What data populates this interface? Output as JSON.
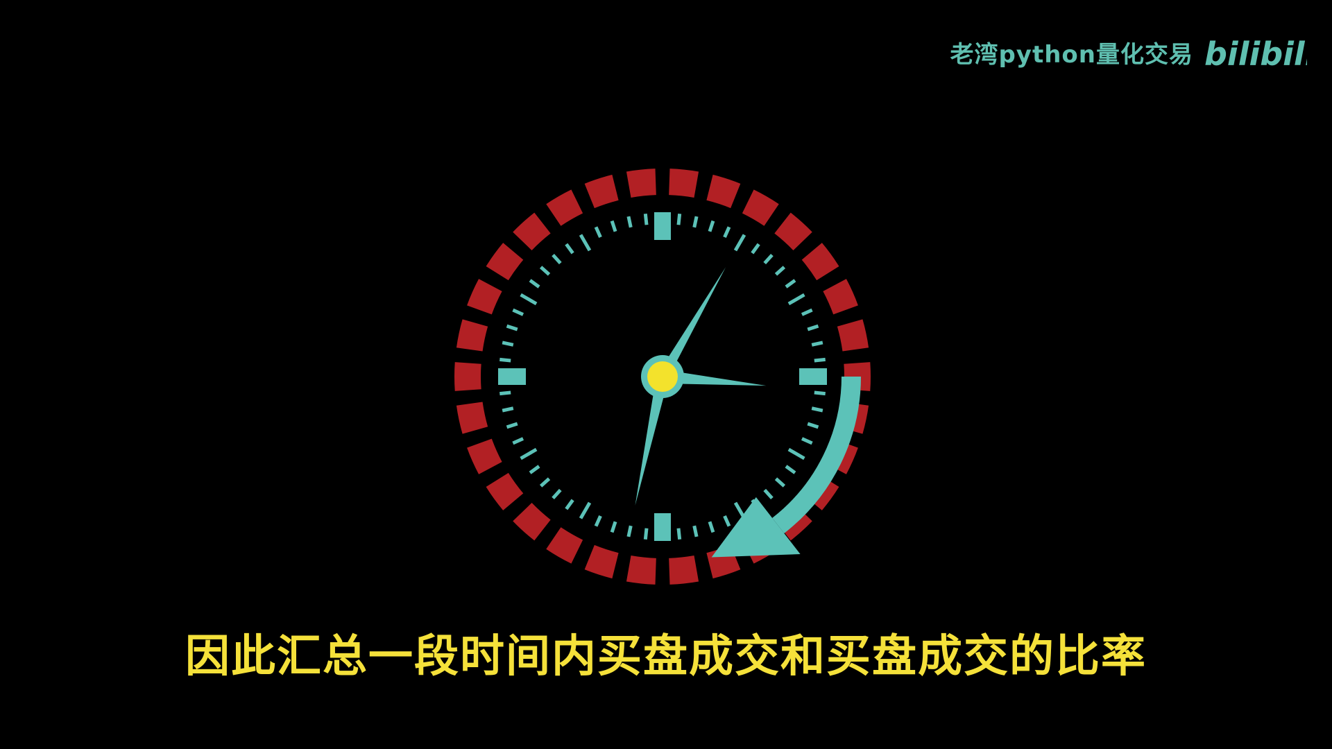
{
  "watermark": {
    "channel_name": "老湾python量化交易",
    "logo_text": "bilibili"
  },
  "subtitle": {
    "text": "因此汇总一段时间内买盘成交和买盘成交的比率"
  },
  "clock": {
    "icon": "clock-icon",
    "hour_hand_minutes": 65,
    "minute_hand_minutes": 32,
    "arrow_icon": "clockwise-arrow-icon"
  },
  "colors": {
    "background": "#000000",
    "accent_teal": "#5cc2b8",
    "ring_red": "#b22024",
    "subtitle_yellow": "#f5e13a",
    "center_yellow": "#f3e22c"
  }
}
